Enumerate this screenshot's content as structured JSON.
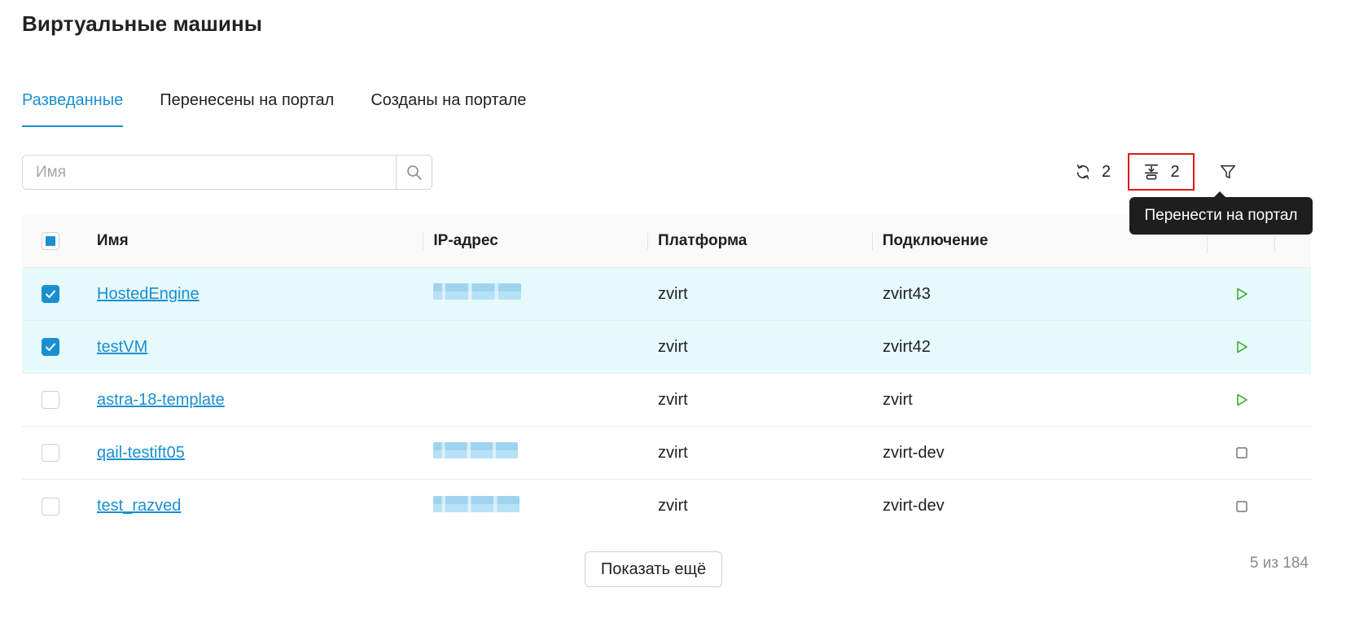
{
  "page": {
    "title": "Виртуальные машины"
  },
  "tabs": [
    {
      "label": "Разведанные",
      "active": true
    },
    {
      "label": "Перенесены на портал",
      "active": false
    },
    {
      "label": "Созданы на портале",
      "active": false
    }
  ],
  "search": {
    "placeholder": "Имя",
    "value": ""
  },
  "toolbar": {
    "refresh_count": "2",
    "transfer_count": "2",
    "tooltip": "Перенести на портал"
  },
  "table": {
    "headers": {
      "name": "Имя",
      "ip": "IP-адрес",
      "platform": "Платформа",
      "connection": "Подключение"
    },
    "rows": [
      {
        "name": "HostedEngine",
        "platform": "zvirt",
        "connection": "zvirt43",
        "checked": true,
        "ip_obscured": true,
        "state": "play"
      },
      {
        "name": "testVM",
        "platform": "zvirt",
        "connection": "zvirt42",
        "checked": true,
        "ip_obscured": false,
        "state": "play"
      },
      {
        "name": "astra-18-template",
        "platform": "zvirt",
        "connection": "zvirt",
        "checked": false,
        "ip_obscured": false,
        "state": "play"
      },
      {
        "name": "qail-testift05",
        "platform": "zvirt",
        "connection": "zvirt-dev",
        "checked": false,
        "ip_obscured": true,
        "state": "stop"
      },
      {
        "name": "test_razved",
        "platform": "zvirt",
        "connection": "zvirt-dev",
        "checked": false,
        "ip_obscured": true,
        "state": "stop"
      }
    ]
  },
  "footer": {
    "show_more_label": "Показать ещё",
    "counter": "5 из 184"
  },
  "colors": {
    "accent": "#1a8fd0",
    "selected_row": "#e6f9fb",
    "play": "#3fae3a",
    "highlight_box": "#e01818"
  }
}
